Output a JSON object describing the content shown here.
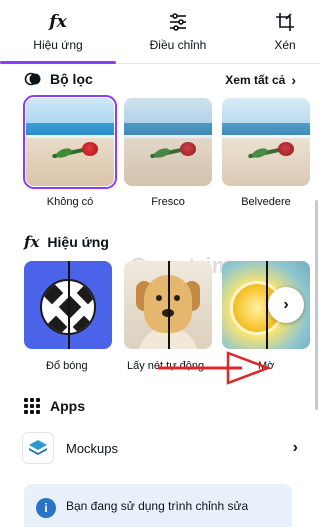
{
  "tabs": [
    {
      "label": "Hiệu ứng",
      "icon": "fx-icon",
      "active": true
    },
    {
      "label": "Điều chỉnh",
      "icon": "sliders-icon"
    },
    {
      "label": "Xén",
      "icon": "crop-icon"
    }
  ],
  "filters": {
    "title": "Bộ lọc",
    "see_all": "Xem tất cả",
    "items": [
      {
        "label": "Không có",
        "selected": true
      },
      {
        "label": "Fresco"
      },
      {
        "label": "Belvedere"
      }
    ]
  },
  "effects": {
    "title": "Hiệu ứng",
    "items": [
      {
        "label": "Đổ bóng"
      },
      {
        "label": "Lấy nét tự động"
      },
      {
        "label": "Mờ"
      }
    ]
  },
  "apps": {
    "title": "Apps",
    "items": [
      {
        "label": "Mockups"
      }
    ]
  },
  "info": {
    "text": "Bạn đang sử dụng trình chỉnh sửa"
  },
  "watermark": "Quantrimang",
  "colors": {
    "accent": "#8b3dff",
    "info_bg": "#e8f1fb",
    "info_icon": "#2a73c9",
    "annotation_arrow": "#e0262b"
  }
}
